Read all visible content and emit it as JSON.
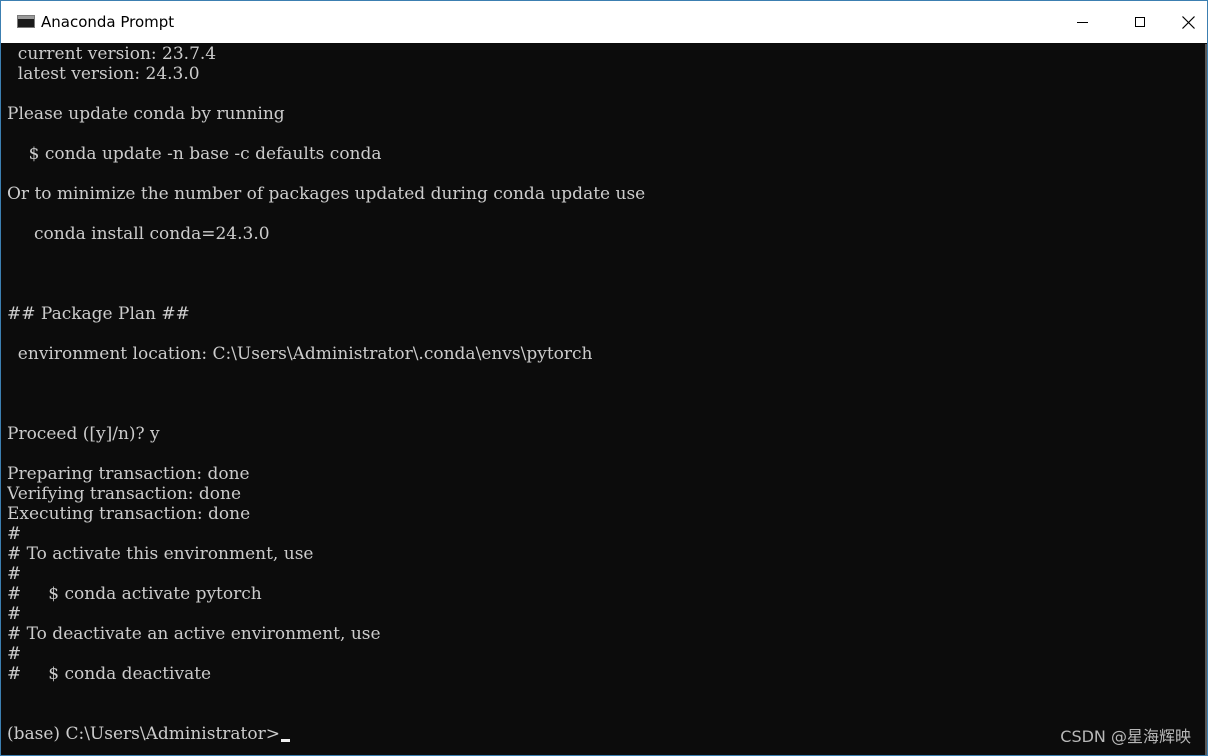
{
  "window": {
    "title": "Anaconda Prompt",
    "icon": "console-icon",
    "controls": {
      "minimize_icon": "minimize-icon",
      "maximize_icon": "maximize-icon",
      "close_icon": "close-icon",
      "close_glyph": "✕"
    }
  },
  "terminal": {
    "lines": [
      "  current version: 23.7.4",
      "  latest version: 24.3.0",
      "",
      "Please update conda by running",
      "",
      "    $ conda update -n base -c defaults conda",
      "",
      "Or to minimize the number of packages updated during conda update use",
      "",
      "     conda install conda=24.3.0",
      "",
      "",
      "",
      "## Package Plan ##",
      "",
      "  environment location: C:\\Users\\Administrator\\.conda\\envs\\pytorch",
      "",
      "",
      "",
      "Proceed ([y]/n)? y",
      "",
      "Preparing transaction: done",
      "Verifying transaction: done",
      "Executing transaction: done",
      "#",
      "# To activate this environment, use",
      "#",
      "#     $ conda activate pytorch",
      "#",
      "# To deactivate an active environment, use",
      "#",
      "#     $ conda deactivate",
      "",
      ""
    ],
    "prompt": "(base) C:\\Users\\Administrator>"
  },
  "watermark": "CSDN @星海辉映",
  "colors": {
    "background": "#0c0c0c",
    "foreground": "#cccccc",
    "titlebar": "#ffffff"
  }
}
